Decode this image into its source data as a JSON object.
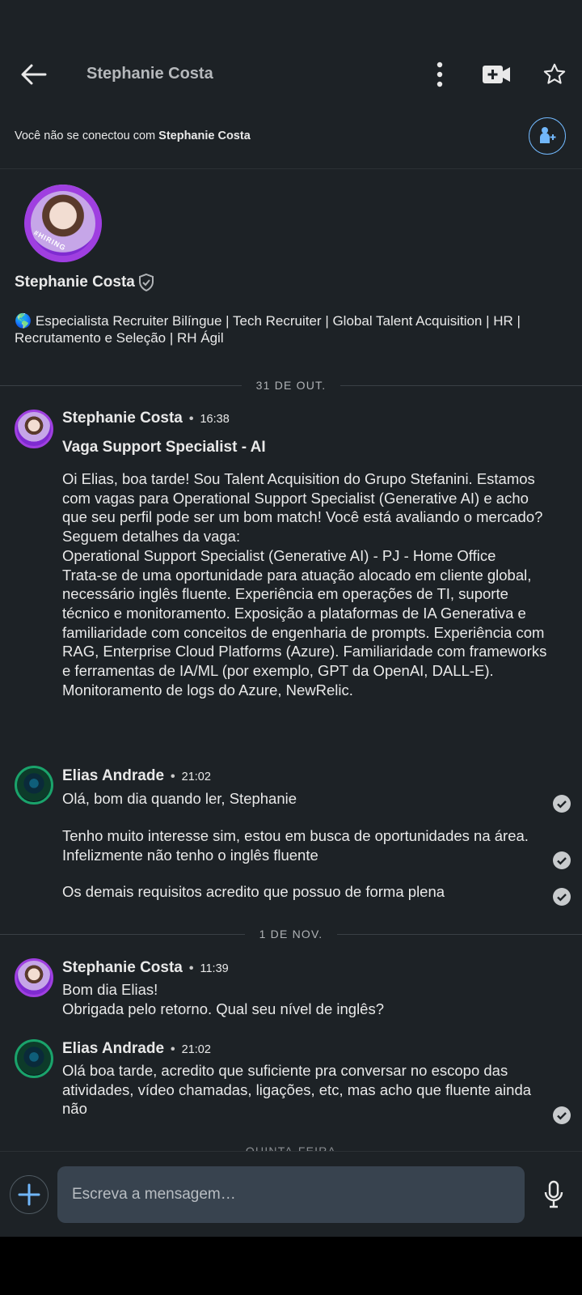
{
  "header": {
    "title": "Stephanie Costa"
  },
  "connect_notice": {
    "prefix": "Você não se conectou com ",
    "name": "Stephanie Costa"
  },
  "profile": {
    "avatar_badge": "#HIRING",
    "name": "Stephanie Costa",
    "headline": "🌎 Especialista Recruiter Bilíngue | Tech Recruiter | Global Talent Acquisition | HR | Recrutamento e Seleção | RH Ágil"
  },
  "dividers": [
    {
      "label": "31 DE OUT."
    },
    {
      "label": "1 DE NOV."
    },
    {
      "label": "QUINTA-FEIRA"
    }
  ],
  "messages": [
    {
      "sender": "Stephanie Costa",
      "time": "16:38",
      "subject": "Vaga Support Specialist - AI",
      "body": "Oi Elias, boa tarde! Sou Talent Acquisition do Grupo Stefanini. Estamos com vagas para Operational Support Specialist (Generative AI) e acho que seu perfil pode ser um bom match! Você está avaliando o mercado?\nSeguem detalhes da vaga:\nOperational Support Specialist (Generative AI) - PJ - Home Office\nTrata-se de uma oportunidade para atuação alocado em cliente global, necessário inglês fluente. Experiência em operações de TI, suporte técnico e monitoramento. Exposição a plataformas de IA Generativa e familiaridade com conceitos de engenharia de prompts. Experiência com RAG, Enterprise Cloud Platforms (Azure). Familiaridade com frameworks e ferramentas de IA/ML (por exemplo, GPT da OpenAI, DALL-E). Monitoramento de logs do Azure, NewRelic."
    },
    {
      "sender": "Elias Andrade",
      "time": "21:02",
      "parts": [
        "Olá,  bom dia quando ler, Stephanie",
        "Tenho muito interesse sim, estou em busca de oportunidades na área. Infelizmente não tenho o inglês fluente",
        "Os demais requisitos acredito que possuo de forma plena"
      ]
    },
    {
      "sender": "Stephanie Costa",
      "time": "11:39",
      "body": "Bom dia Elias!\nObrigada pelo retorno. Qual seu nível de inglês?"
    },
    {
      "sender": "Elias Andrade",
      "time": "21:02",
      "body": "Olá boa tarde, acredito que suficiente pra conversar no escopo das atividades, vídeo chamadas, ligações, etc, mas acho que fluente ainda não"
    }
  ],
  "composer": {
    "placeholder": "Escreva a mensagem…"
  },
  "colors": {
    "background": "#1d2226",
    "accent": "#71b7fb",
    "input_bg": "#38434f",
    "hiring_purple": "#9f3fe0"
  }
}
